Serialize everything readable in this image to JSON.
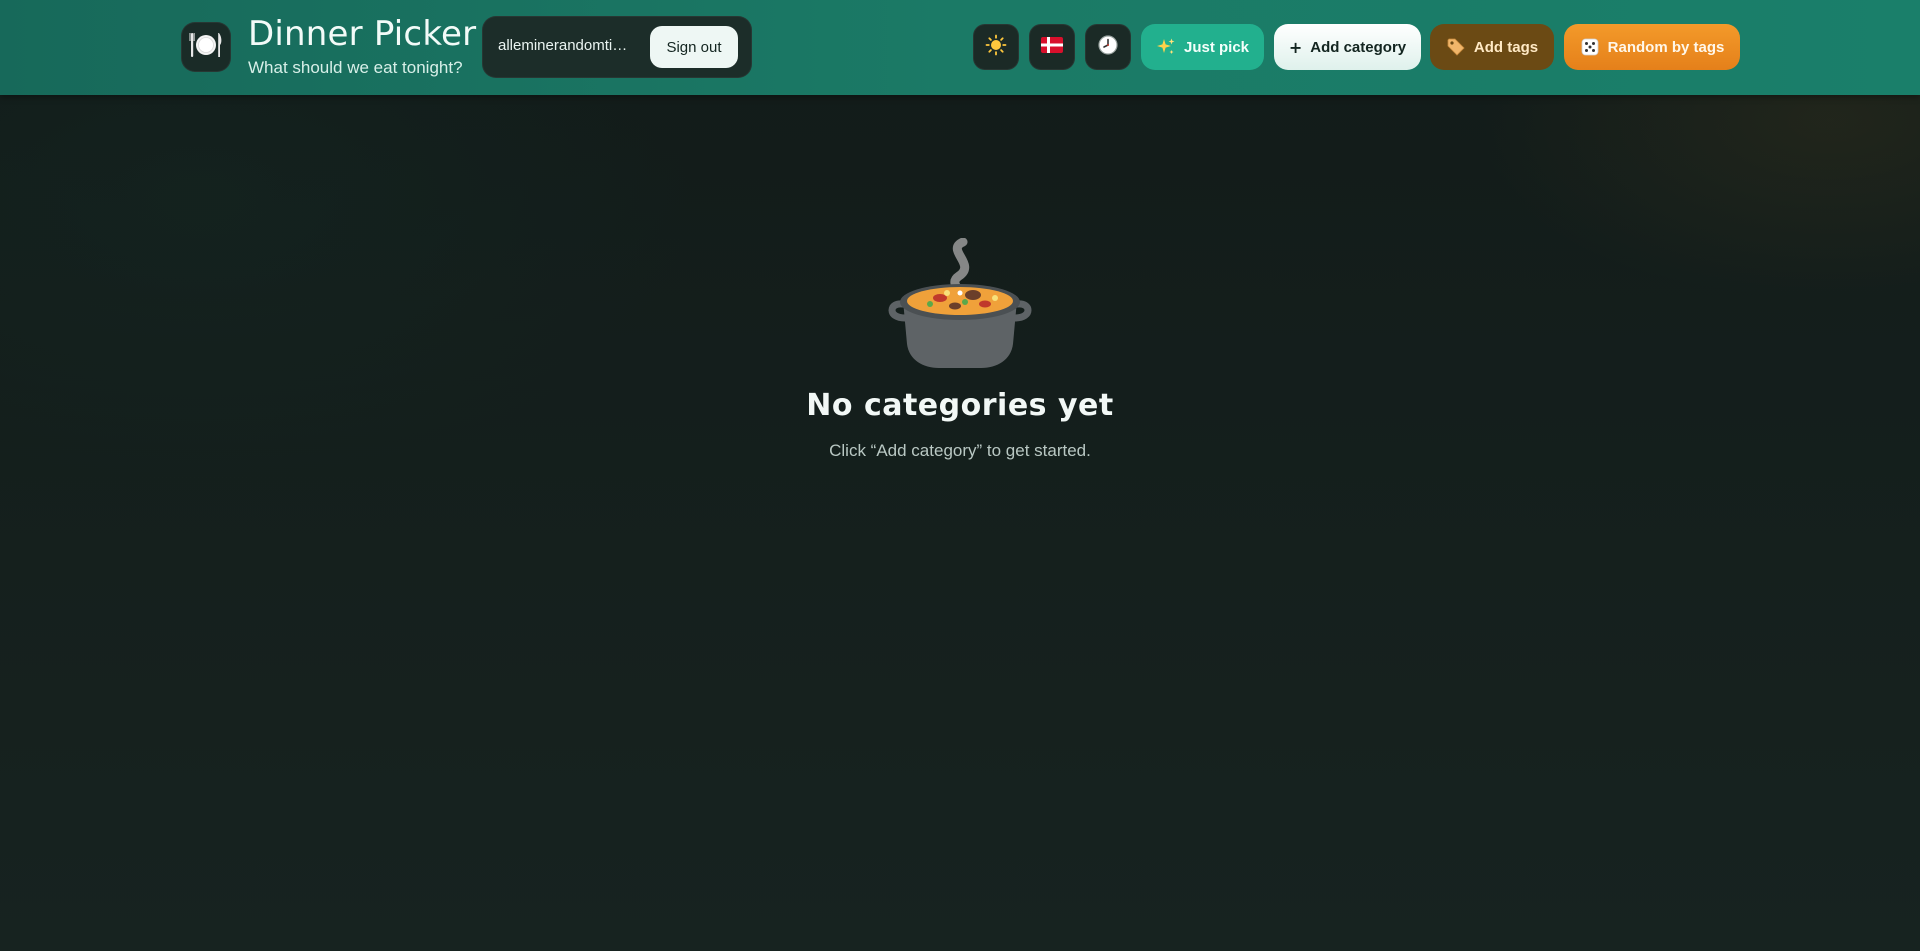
{
  "header": {
    "logo_icon": "plate-cutlery-icon",
    "title": "Dinner Picker",
    "subtitle": "What should we eat tonight?",
    "user": {
      "email": "alleminerandomti…",
      "signout_label": "Sign out"
    },
    "icon_buttons": [
      {
        "name": "theme-toggle",
        "icon": "sun-icon"
      },
      {
        "name": "language-select",
        "icon": "danish-flag-icon"
      },
      {
        "name": "history",
        "icon": "clock-icon"
      }
    ],
    "actions": {
      "just_pick_label": "Just pick",
      "just_pick_icon": "sparkles-icon",
      "add_category_label": "Add category",
      "add_category_icon": "plus-icon",
      "add_tags_label": "Add tags",
      "add_tags_icon": "tag-icon",
      "random_by_tags_label": "Random by tags",
      "random_by_tags_icon": "dice-icon"
    }
  },
  "empty_state": {
    "icon": "pot-of-food-icon",
    "title": "No categories yet",
    "message": "Click “Add category” to get started."
  },
  "colors": {
    "header_bg": "#1b7a66",
    "page_bg": "#17211e",
    "just_pick": "#22b08e",
    "add_tags": "#6b4a14",
    "random_by_tags": "#f39a2a"
  }
}
